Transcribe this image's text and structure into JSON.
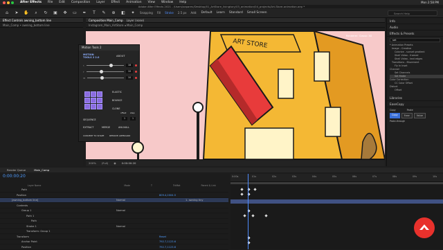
{
  "menubar": {
    "app": "After Effects",
    "items": [
      "File",
      "Edit",
      "Composition",
      "Layer",
      "Effect",
      "Animation",
      "View",
      "Window",
      "Help"
    ],
    "clock": "Mon 2:58 PM"
  },
  "window_title": "Adobe After Effects 2021 - /Users/xaparev/Desktop/01_ArtStore_livingtory/03_animation/04_projects/Art-Store-animation.aep *",
  "toolbar": {
    "snapping": "Snapping",
    "fill": "Fill",
    "stroke": "Stroke",
    "stroke_px": "2.5 px",
    "add": "Add:",
    "workspaces": [
      "Default",
      "Learn",
      "Standard",
      "Small Screen"
    ],
    "active_ws": "Animation",
    "search": "Search Help"
  },
  "left_panel": {
    "header": "Effect Controls awning_bottom line",
    "subheader": "Main_Comp • awning_bottom line"
  },
  "comp_panel": {
    "header": "Composition Main_Comp",
    "layer_tab": "Layer (none)",
    "breadcrumb": [
      "Instagram_Main_ArtStore",
      "Main_Comp"
    ],
    "renderer": "Renderer: Classic 3D",
    "zoom": "200%",
    "resolution": "(Full)",
    "timecode": "0:00:00:20"
  },
  "store_sign": "ART STORE",
  "motion_tools": {
    "title": "Motion Tools 2",
    "brand": "MOTION TOOLS 2 2.0",
    "about": "ABOUT",
    "sliders": [
      {
        "value": "18"
      },
      {
        "value": "10"
      },
      {
        "value": "10"
      }
    ],
    "buttons": [
      "ELASTIC",
      "BOUNCE",
      "CLONE",
      "SEQUENCE",
      "EXTRACT",
      "MERGE",
      "ANI-NULL",
      "CONVERT TO SHAPE",
      "REMOVE ARTBOARD"
    ],
    "offset_label": "offset",
    "step_label": "step",
    "offset": "1",
    "step": "1"
  },
  "right_panel": {
    "sections": [
      "Info",
      "Audio",
      "Effects & Presets",
      "Libraries",
      "EaseCopy"
    ],
    "search": "set",
    "tree": [
      "* Animation Presets",
      "Image - Creative",
      "Colorize - sunset gradient",
      "Shell Video - framed",
      "Shell Video - text edges",
      "Transitions - Movement",
      "Fly In Inset",
      "Channel",
      "Set Channels",
      "Set Matte",
      "Color Correction",
      "CC Color Offset",
      "Distort",
      "Offset"
    ],
    "easecopy": {
      "copy_label": "Copy",
      "paste_label": "Paste",
      "copy": "Copy",
      "ease": "Ease",
      "value": "Value",
      "paste_through": "Paste-through"
    }
  },
  "timeline": {
    "tabs": [
      "Render Queue",
      "Main_Comp"
    ],
    "timecode": "0:00:00:20",
    "columns": [
      "Layer Name",
      "Mode",
      "T",
      "TrkMat",
      "Parent & Link"
    ],
    "rows": [
      {
        "label": "Path",
        "indent": 3
      },
      {
        "label": "Position",
        "value": "809.4,2004.5",
        "indent": 2
      },
      {
        "label": "[awning_bottom line]",
        "mode": "Normal",
        "parent": "1. awning tiny",
        "selected": true,
        "indent": 1
      },
      {
        "label": "Contents",
        "indent": 2
      },
      {
        "label": "Group 1",
        "mode": "Normal",
        "indent": 3
      },
      {
        "label": "Path 1",
        "indent": 4
      },
      {
        "label": "Path",
        "indent": 5
      },
      {
        "label": "Stroke 1",
        "mode": "Normal",
        "indent": 4
      },
      {
        "label": "Transform: Group 1",
        "indent": 4
      },
      {
        "label": "Transform",
        "value": "Reset",
        "indent": 2
      },
      {
        "label": "Anchor Point",
        "value": "792.7,1123.6",
        "indent": 3
      },
      {
        "label": "Position",
        "value": "792.7,1123.6",
        "indent": 3
      }
    ],
    "ruler": [
      "0:00s",
      "01s",
      "02s",
      "03s",
      "04s",
      "05s",
      "06s",
      "07s",
      "08s",
      "09s",
      "10s"
    ]
  },
  "colors": {
    "accent": "#4f8dff",
    "awning": "#e83b3b",
    "building": "#f4b834",
    "pink": "#f7c9c9",
    "purple": "#8b6ce0",
    "logo": "#e8312c"
  }
}
